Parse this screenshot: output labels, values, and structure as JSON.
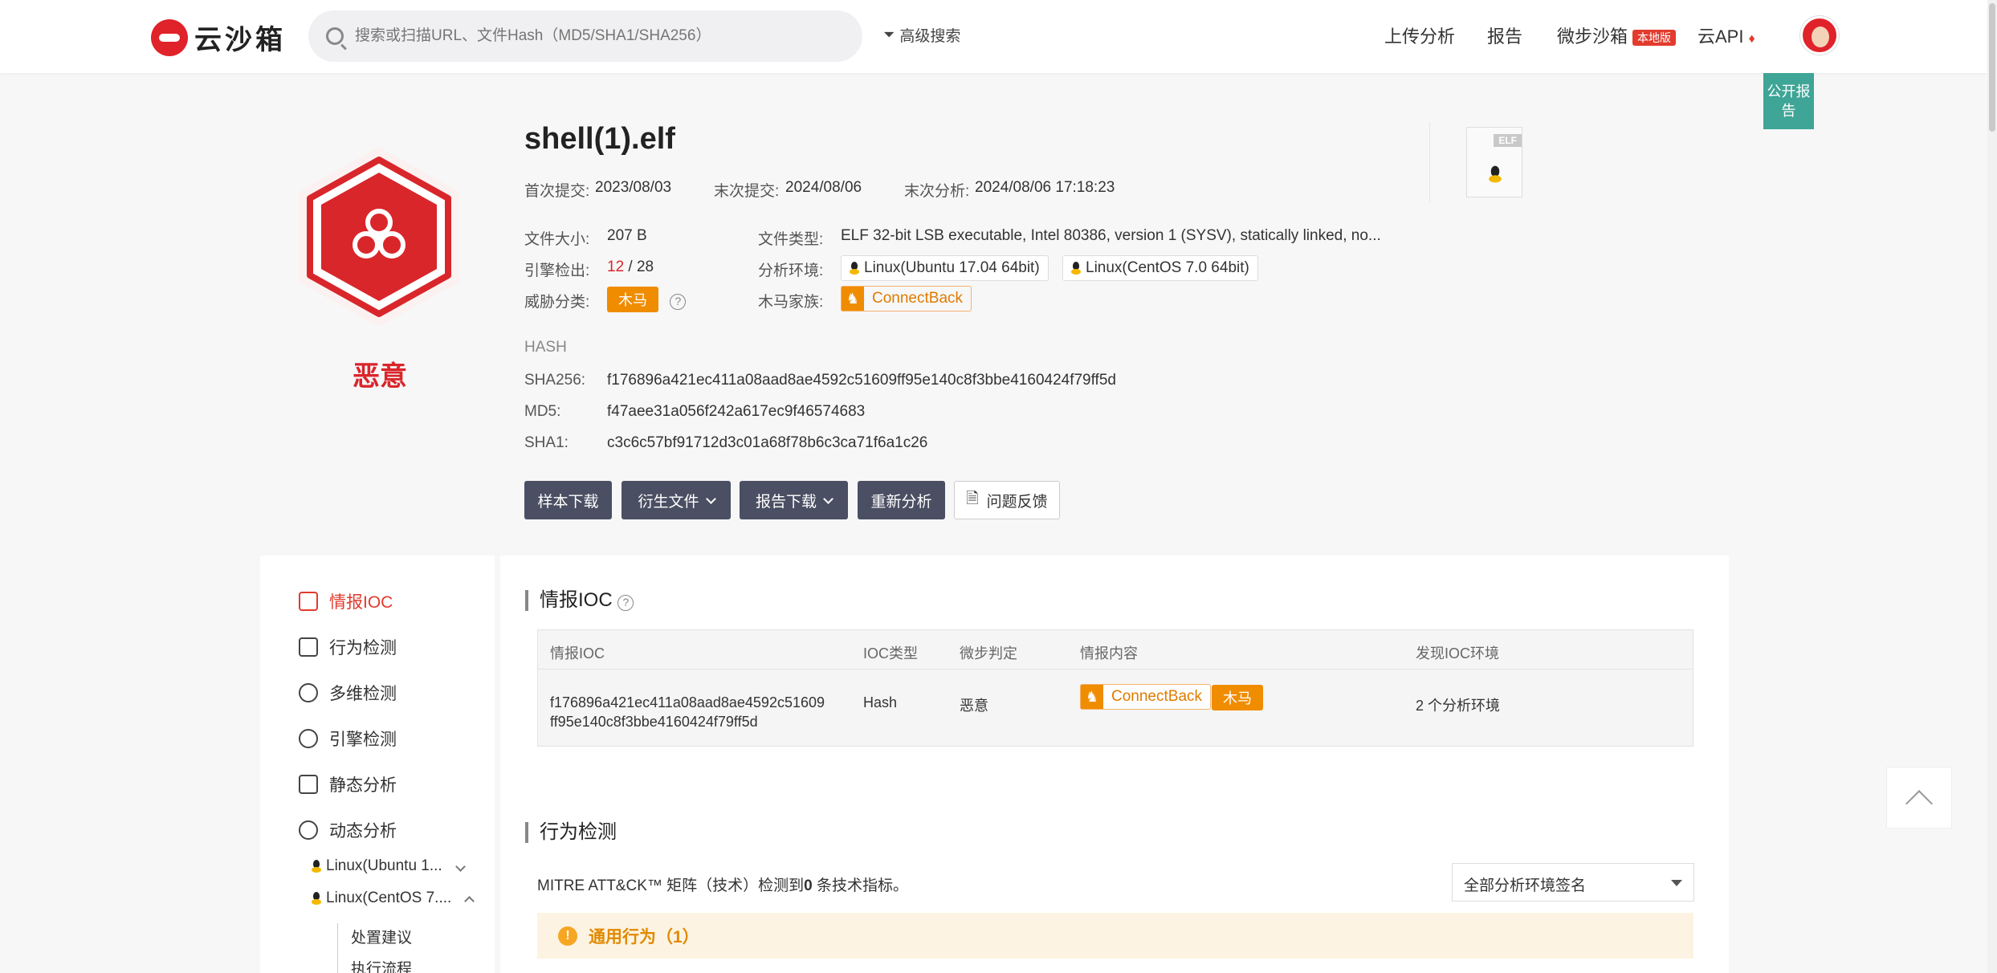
{
  "header": {
    "logo_text": "云沙箱",
    "search_placeholder": "搜索或扫描URL、文件Hash（MD5/SHA1/SHA256）",
    "advanced_search": "高级搜索",
    "nav": {
      "upload": "上传分析",
      "report": "报告",
      "weibu": "微步沙箱",
      "local_badge": "本地版",
      "api": "云API"
    }
  },
  "public_report": "公开报告",
  "verdict": "恶意",
  "file": {
    "name": "shell(1).elf",
    "first_submit_label": "首次提交:",
    "first_submit": "2023/08/03",
    "last_submit_label": "末次提交:",
    "last_submit": "2024/08/06",
    "last_analysis_label": "末次分析:",
    "last_analysis": "2024/08/06 17:18:23",
    "size_label": "文件大小:",
    "size": "207 B",
    "type_label": "文件类型:",
    "type": "ELF 32-bit LSB executable, Intel 80386, version 1 (SYSV), statically linked, no...",
    "engine_label": "引擎检出:",
    "engine_hits": "12",
    "engine_total": "/ 28",
    "env_label": "分析环境:",
    "envs": [
      "Linux(Ubuntu 17.04 64bit)",
      "Linux(CentOS 7.0 64bit)"
    ],
    "threat_label": "威胁分类:",
    "threat": "木马",
    "family_label": "木马家族:",
    "family": "ConnectBack",
    "thumb_tag": "ELF"
  },
  "hash": {
    "heading": "HASH",
    "sha256_label": "SHA256:",
    "sha256": "f176896a421ec411a08aad8ae4592c51609ff95e140c8f3bbe4160424f79ff5d",
    "md5_label": "MD5:",
    "md5": "f47aee31a056f242a617ec9f46574683",
    "sha1_label": "SHA1:",
    "sha1": "c3c6c57bf91712d3c01a68f78b6c3ca71f6a1c26"
  },
  "actions": {
    "download_sample": "样本下载",
    "derived_files": "衍生文件",
    "download_report": "报告下载",
    "reanalyze": "重新分析",
    "feedback": "问题反馈"
  },
  "sidebar": {
    "items": [
      "情报IOC",
      "行为检测",
      "多维检测",
      "引擎检测",
      "静态分析",
      "动态分析"
    ],
    "sub_envs": [
      "Linux(Ubuntu 1...",
      "Linux(CentOS 7...."
    ],
    "tree": [
      "处置建议",
      "执行流程"
    ]
  },
  "ioc": {
    "title": "情报IOC",
    "columns": [
      "情报IOC",
      "IOC类型",
      "微步判定",
      "情报内容",
      "发现IOC环境"
    ],
    "row": {
      "ioc_line1": "f176896a421ec411a08aad8ae4592c51609",
      "ioc_line2": "ff95e140c8f3bbe4160424f79ff5d",
      "type": "Hash",
      "judgement": "恶意",
      "family": "ConnectBack",
      "tag": "木马",
      "envs": "2 个分析环境"
    }
  },
  "behavior": {
    "title": "行为检测",
    "mitre_prefix": "MITRE ATT&CK™ 矩阵（技术）检测到",
    "mitre_count": "0",
    "mitre_suffix": " 条技术指标。",
    "select": "全部分析环境签名",
    "general": "通用行为（1）"
  }
}
